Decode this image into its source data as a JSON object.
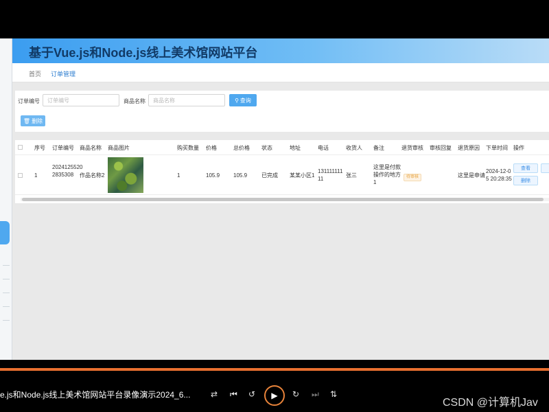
{
  "app": {
    "title": "基于Vue.js和Node.js线上美术馆网站平台"
  },
  "breadcrumb": {
    "home": "首页",
    "current": "订单管理"
  },
  "search": {
    "order_no_label": "订单编号",
    "order_no_placeholder": "订单编号",
    "product_name_label": "商品名称",
    "product_name_placeholder": "商品名称",
    "search_button": "查询",
    "delete_button": "删除"
  },
  "table": {
    "headers": [
      "序号",
      "订单编号",
      "商品名称",
      "商品图片",
      "购买数量",
      "价格",
      "总价格",
      "状态",
      "地址",
      "电话",
      "收货人",
      "备注",
      "退货审核",
      "审核回复",
      "退货原因",
      "下单时间",
      "操作"
    ],
    "rows": [
      {
        "index": "1",
        "order_no_line1": "2024125520",
        "order_no_line2": "2835308",
        "product_name": "作品名称2",
        "quantity": "1",
        "price": "105.9",
        "total": "105.9",
        "status": "已完成",
        "address": "某某小区1",
        "phone_line1": "131111111",
        "phone_line2": "11",
        "receiver": "张三",
        "note_line1": "这里是付款",
        "note_line2": "操作的地方",
        "note_line3": "1",
        "return_review": "待审核",
        "return_reason": "这里是申请",
        "order_time_line1": "2024-12-0",
        "order_time_line2": "5 20:28:35",
        "op_view": "查看",
        "op_delete": "删除"
      }
    ]
  },
  "player": {
    "title": "e.js和Node.js线上美术馆网站平台录像演示2024_6...",
    "watermark": "CSDN @计算机Jav"
  },
  "colors": {
    "accent": "#4fa8ef",
    "progress": "#e86f2f"
  }
}
